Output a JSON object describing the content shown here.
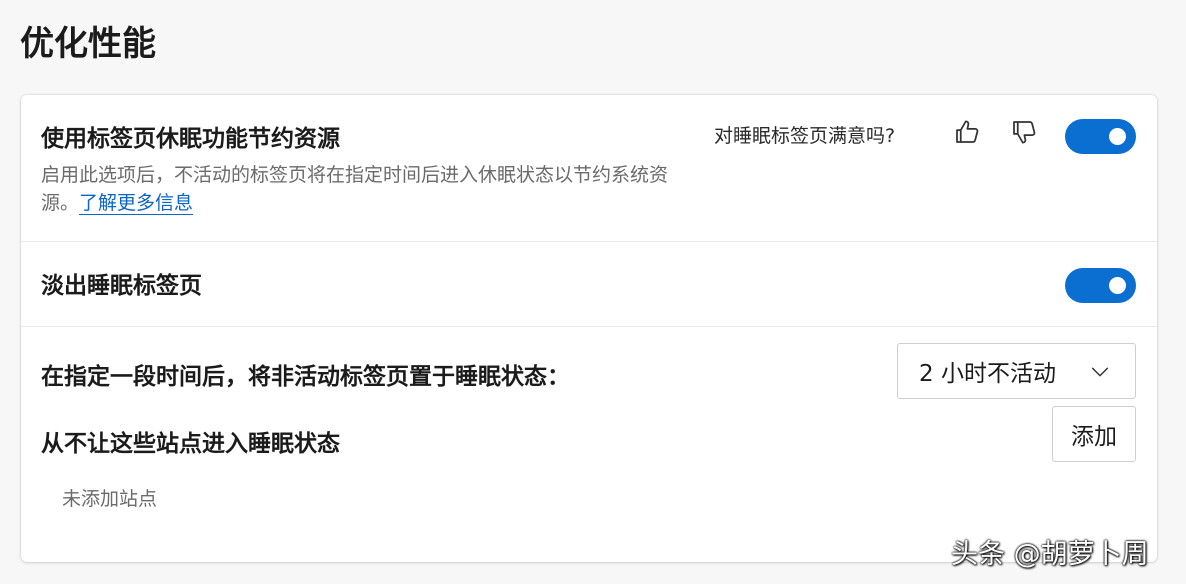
{
  "page": {
    "title": "优化性能"
  },
  "sleeping_tabs": {
    "title": "使用标签页休眠功能节约资源",
    "description": "启用此选项后，不活动的标签页将在指定时间后进入休眠状态以节约系统资源。",
    "learn_more": "了解更多信息",
    "feedback_question": "对睡眠标签页满意吗?",
    "thumb_up_icon": "thumbs-up-icon",
    "thumb_down_icon": "thumbs-down-icon",
    "enabled": true
  },
  "fade_sleeping_tabs": {
    "title": "淡出睡眠标签页",
    "enabled": true
  },
  "sleep_after": {
    "label": "在指定一段时间后，将非活动标签页置于睡眠状态：",
    "selected_value": "2 小时不活动",
    "chevron_icon": "chevron-down-icon"
  },
  "never_sleep_sites": {
    "label": "从不让这些站点进入睡眠状态",
    "add_button": "添加",
    "empty_text": "未添加站点"
  },
  "watermark": "头条 @胡萝卜周",
  "colors": {
    "accent": "#0b6fd1",
    "link": "#0b66c3",
    "background": "#f7f7f7",
    "card": "#ffffff"
  }
}
